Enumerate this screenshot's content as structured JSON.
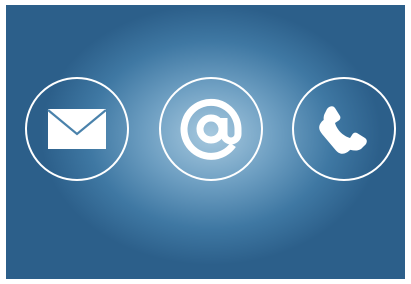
{
  "image": {
    "background_colors": {
      "center": "#a7c9df",
      "mid": "#6e9fc2",
      "edge": "#2c5f8a",
      "frame": "#ffffff"
    },
    "icon_color": "#ffffff",
    "icons": [
      {
        "name": "envelope-icon"
      },
      {
        "name": "at-sign-icon"
      },
      {
        "name": "telephone-icon"
      }
    ]
  }
}
